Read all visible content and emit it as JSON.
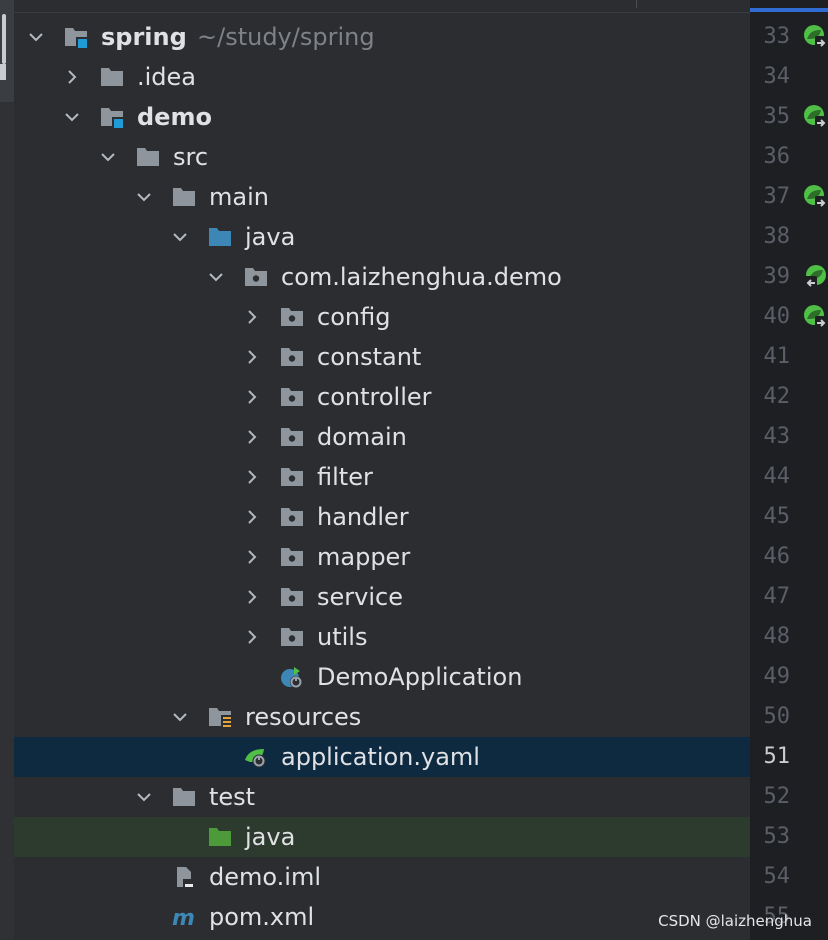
{
  "project_tree": {
    "rows": [
      {
        "label": "spring",
        "hint": "~/study/spring",
        "bold": true,
        "icon": "module-folder-icon",
        "chevron": "down",
        "depth": 0
      },
      {
        "label": ".idea",
        "icon": "folder-icon",
        "chevron": "right",
        "depth": 1
      },
      {
        "label": "demo",
        "bold": true,
        "icon": "module-folder-icon",
        "chevron": "down",
        "depth": 1
      },
      {
        "label": "src",
        "icon": "folder-icon",
        "chevron": "down",
        "depth": 2
      },
      {
        "label": "main",
        "icon": "folder-icon",
        "chevron": "down",
        "depth": 3
      },
      {
        "label": "java",
        "icon": "source-root-folder-icon",
        "chevron": "down",
        "depth": 4
      },
      {
        "label": "com.laizhenghua.demo",
        "icon": "package-icon",
        "chevron": "down",
        "depth": 5
      },
      {
        "label": "config",
        "icon": "package-icon",
        "chevron": "right",
        "depth": 6
      },
      {
        "label": "constant",
        "icon": "package-icon",
        "chevron": "right",
        "depth": 6
      },
      {
        "label": "controller",
        "icon": "package-icon",
        "chevron": "right",
        "depth": 6
      },
      {
        "label": "domain",
        "icon": "package-icon",
        "chevron": "right",
        "depth": 6
      },
      {
        "label": "filter",
        "icon": "package-icon",
        "chevron": "right",
        "depth": 6
      },
      {
        "label": "handler",
        "icon": "package-icon",
        "chevron": "right",
        "depth": 6
      },
      {
        "label": "mapper",
        "icon": "package-icon",
        "chevron": "right",
        "depth": 6
      },
      {
        "label": "service",
        "icon": "package-icon",
        "chevron": "right",
        "depth": 6
      },
      {
        "label": "utils",
        "icon": "package-icon",
        "chevron": "right",
        "depth": 6
      },
      {
        "label": "DemoApplication",
        "icon": "spring-boot-class-icon",
        "chevron": "none",
        "depth": 6
      },
      {
        "label": "resources",
        "icon": "resources-folder-icon",
        "chevron": "down",
        "depth": 4
      },
      {
        "label": "application.yaml",
        "icon": "spring-yaml-config-icon",
        "chevron": "none",
        "depth": 5,
        "state": "selected"
      },
      {
        "label": "test",
        "icon": "folder-icon",
        "chevron": "down",
        "depth": 3
      },
      {
        "label": "java",
        "icon": "test-source-folder-icon",
        "chevron": "none",
        "depth": 4,
        "state": "highlight"
      },
      {
        "label": "demo.iml",
        "icon": "iml-file-icon",
        "chevron": "none",
        "depth": 3
      },
      {
        "label": "pom.xml",
        "icon": "maven-icon",
        "chevron": "none",
        "depth": 3
      }
    ]
  },
  "gutter": {
    "line_numbers": [
      "33",
      "34",
      "35",
      "36",
      "37",
      "38",
      "39",
      "40",
      "41",
      "42",
      "43",
      "44",
      "45",
      "46",
      "47",
      "48",
      "49",
      "50",
      "51",
      "52",
      "53",
      "54",
      "55"
    ],
    "current_line": "51",
    "markers": [
      {
        "line": "33",
        "icon": "spring-bean-navigate-icon"
      },
      {
        "line": "35",
        "icon": "spring-bean-navigate-icon"
      },
      {
        "line": "37",
        "icon": "spring-bean-navigate-icon"
      },
      {
        "line": "39",
        "icon": "spring-bean-navigate-back-icon"
      },
      {
        "line": "40",
        "icon": "spring-bean-navigate-icon"
      }
    ]
  },
  "watermark": "CSDN @laizhenghua",
  "colors": {
    "tree_bg": "#2b2d30",
    "gutter_bg": "#1e1f22",
    "selected_row": "#0e2a40",
    "highlight_row": "#2d3a2e",
    "folder": "#8e959d",
    "module_badge": "#1f9bd8",
    "source_root": "#3d87b7",
    "test_root": "#4d9a3a",
    "text": "#dfe1e5"
  }
}
